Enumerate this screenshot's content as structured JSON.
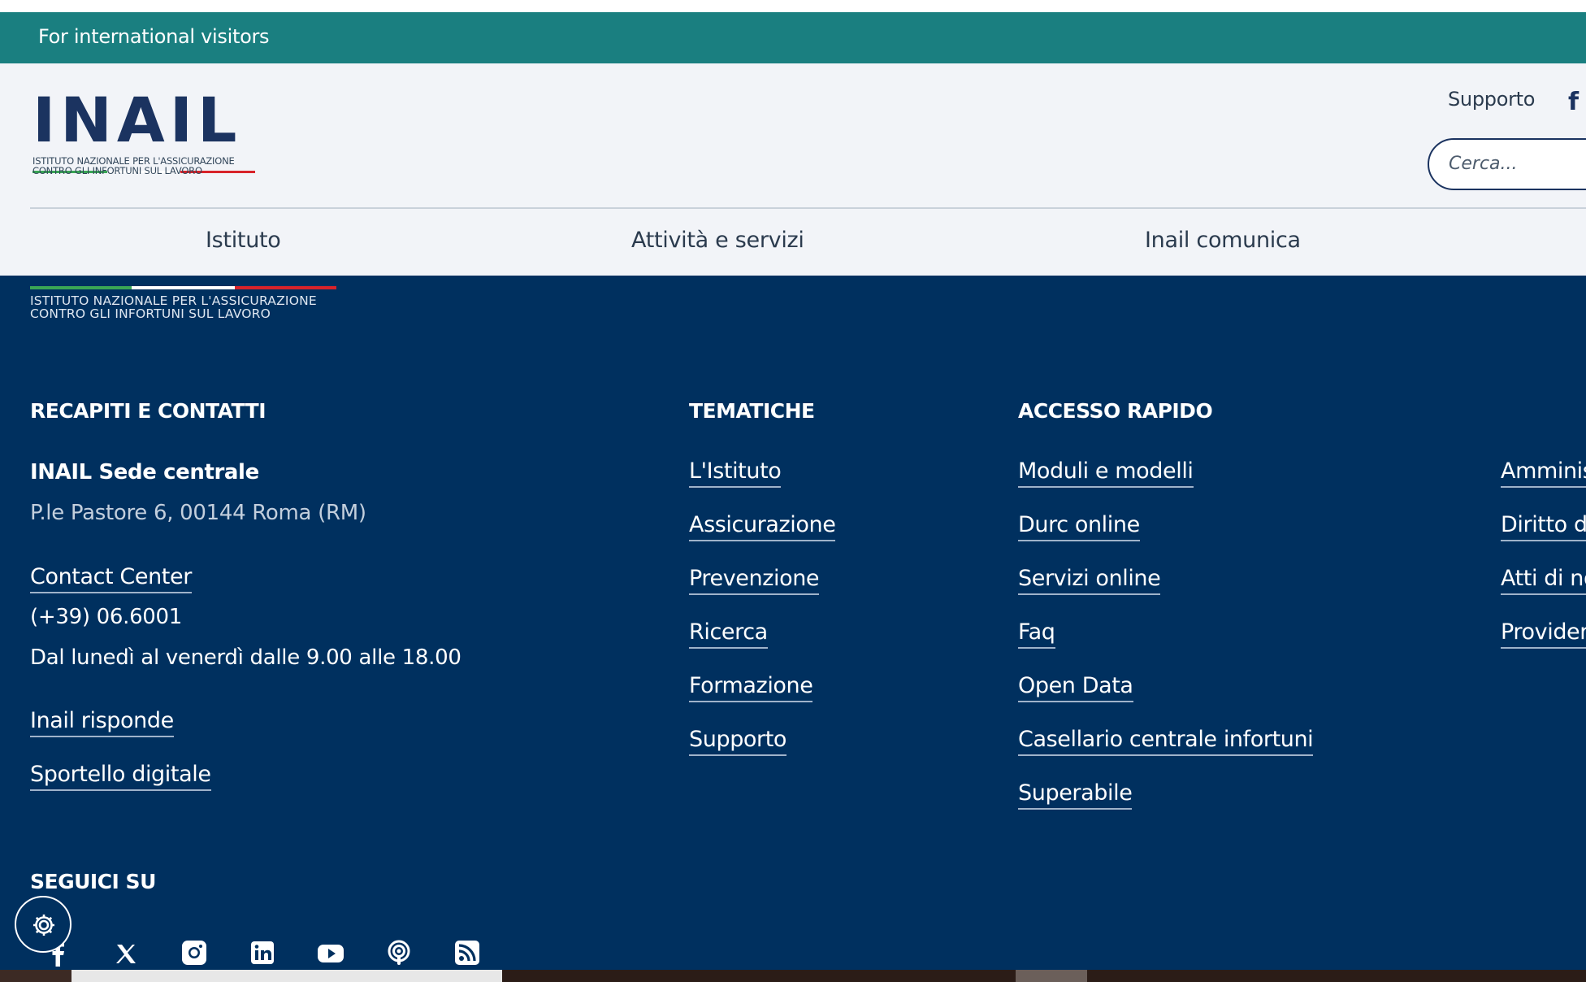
{
  "intl_bar": {
    "label": "For international visitors"
  },
  "header": {
    "logo": {
      "text": "INAIL",
      "subtitle_line1": "ISTITUTO NAZIONALE PER L'ASSICURAZIONE",
      "subtitle_line2": "CONTRO GLI INFORTUNI SUL LAVORO"
    },
    "utility_link": "Supporto",
    "search": {
      "placeholder": "Cerca..."
    }
  },
  "nav": {
    "items": [
      {
        "label": "Istituto"
      },
      {
        "label": "Attività e servizi"
      },
      {
        "label": "Inail comunica"
      }
    ]
  },
  "footer": {
    "subtitle_line1": "ISTITUTO NAZIONALE PER L'ASSICURAZIONE",
    "subtitle_line2": "CONTRO GLI INFORTUNI SUL LAVORO",
    "contacts": {
      "title": "RECAPITI E CONTATTI",
      "sede_name": "INAIL Sede centrale",
      "address": "P.le Pastore 6, 00144 Roma (RM)",
      "contact_center": "Contact Center",
      "phone": "(+39) 06.6001",
      "hours": "Dal lunedì al venerdì dalle 9.00 alle 18.00",
      "inail_risponde": "Inail risponde",
      "sportello": "Sportello digitale"
    },
    "tematiche": {
      "title": "TEMATICHE",
      "links": [
        "L'Istituto",
        "Assicurazione",
        "Prevenzione",
        "Ricerca",
        "Formazione",
        "Supporto"
      ]
    },
    "accesso_rapido": {
      "title": "ACCESSO RAPIDO",
      "links": [
        "Moduli e modelli",
        "Durc online",
        "Servizi online",
        "Faq",
        "Open Data",
        "Casellario centrale infortuni",
        "Superabile"
      ]
    },
    "extra_links": [
      "Amminis",
      "Diritto di",
      "Atti di no",
      "Provider"
    ],
    "seguici": {
      "title": "SEGUICI SU"
    }
  },
  "colors": {
    "intl_bar": "#1a7f80",
    "header_bg": "#f2f4f8",
    "footer_bg": "#00305f",
    "brand_navy": "#1b3360",
    "tricolor_green": "#3aa655",
    "tricolor_red": "#d8232a"
  },
  "icons": {
    "header_social": "facebook-icon",
    "social": [
      "facebook-icon",
      "x-icon",
      "instagram-icon",
      "linkedin-icon",
      "youtube-icon",
      "podcast-icon",
      "rss-icon"
    ],
    "accessibility": "settings-gear-icon"
  }
}
